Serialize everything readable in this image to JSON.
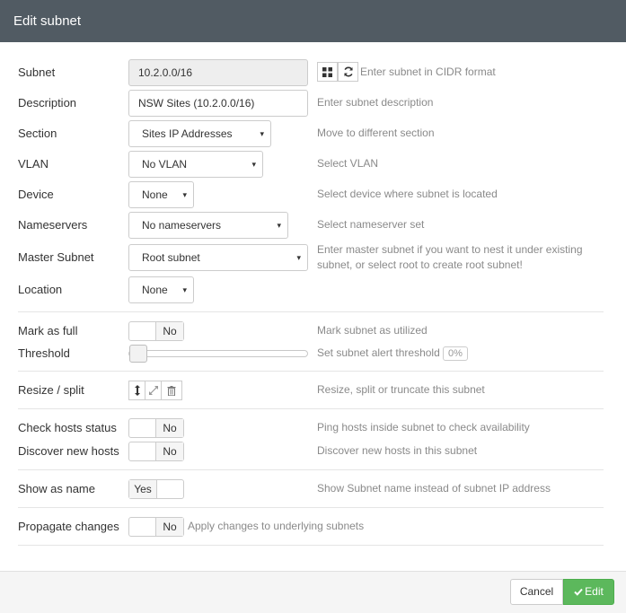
{
  "modal": {
    "title": "Edit subnet"
  },
  "fields": {
    "subnet": {
      "label": "Subnet",
      "value": "10.2.0.0/16",
      "hint": "Enter subnet in CIDR format"
    },
    "description": {
      "label": "Description",
      "value": "NSW Sites (10.2.0.0/16)",
      "hint": "Enter subnet description"
    },
    "section": {
      "label": "Section",
      "value": "Sites IP Addresses",
      "hint": "Move to different section"
    },
    "vlan": {
      "label": "VLAN",
      "value": "No VLAN",
      "hint": "Select VLAN"
    },
    "device": {
      "label": "Device",
      "value": "None",
      "hint": "Select device where subnet is located"
    },
    "nameservers": {
      "label": "Nameservers",
      "value": "No nameservers",
      "hint": "Select nameserver set"
    },
    "master_subnet": {
      "label": "Master Subnet",
      "value": "Root subnet",
      "hint_line1": "Enter master subnet if you want to nest it under existing",
      "hint_line2": "subnet, or select root to create root subnet!"
    },
    "location": {
      "label": "Location",
      "value": "None"
    },
    "mark_full": {
      "label": "Mark as full",
      "state": "No",
      "hint": "Mark subnet as utilized"
    },
    "threshold": {
      "label": "Threshold",
      "hint": "Set subnet alert threshold",
      "value": "0%"
    },
    "resize": {
      "label": "Resize / split",
      "hint": "Resize, split or truncate this subnet"
    },
    "check_hosts": {
      "label": "Check hosts status",
      "state": "No",
      "hint": "Ping hosts inside subnet to check availability"
    },
    "discover_hosts": {
      "label": "Discover new hosts",
      "state": "No",
      "hint": "Discover new hosts in this subnet"
    },
    "show_name": {
      "label": "Show as name",
      "state": "Yes",
      "hint": "Show Subnet name instead of subnet IP address"
    },
    "propagate": {
      "label": "Propagate changes",
      "state": "No",
      "hint": "Apply changes to underlying subnets"
    }
  },
  "icons": {
    "caret": "▾",
    "grid": "grid-icon",
    "refresh": "refresh-icon",
    "resize": "resize-vertical-icon",
    "split": "expand-icon",
    "trash": "trash-icon"
  },
  "footer": {
    "cancel_label": "Cancel",
    "edit_label": "Edit"
  },
  "colors": {
    "header": "#515b63",
    "primary": "#5cb85c"
  }
}
